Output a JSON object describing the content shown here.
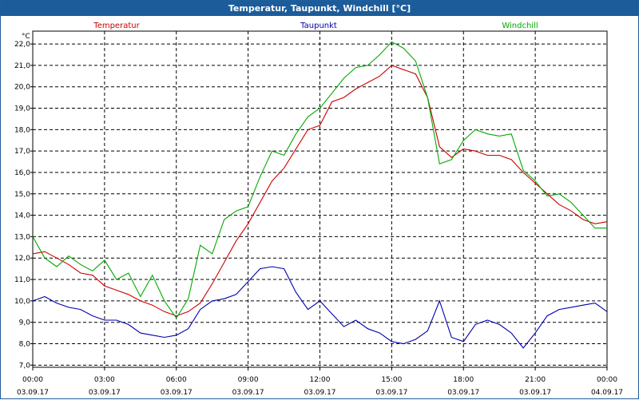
{
  "window": {
    "title": "Temperatur, Taupunkt, Windchill [°C]"
  },
  "colors": {
    "titlebar": "#1c5c9a",
    "grid": "#000000",
    "axis": "#000000"
  },
  "chart_data": {
    "type": "line",
    "ylabel": "°C",
    "ylim": [
      6.9,
      22.6
    ],
    "yticks": [
      "22,0",
      "21,0",
      "20,0",
      "19,0",
      "18,0",
      "17,0",
      "16,0",
      "15,0",
      "14,0",
      "13,0",
      "12,0",
      "11,0",
      "10,0",
      "9,0",
      "8,0",
      "7,0"
    ],
    "ytick_values": [
      22,
      21,
      20,
      19,
      18,
      17,
      16,
      15,
      14,
      13,
      12,
      11,
      10,
      9,
      8,
      7
    ],
    "x_hours": [
      0,
      3,
      6,
      9,
      12,
      15,
      18,
      21,
      24
    ],
    "x_time_labels": [
      "00:00",
      "03:00",
      "06:00",
      "09:00",
      "12:00",
      "15:00",
      "18:00",
      "21:00",
      "00:00"
    ],
    "x_date_labels": [
      "03.09.17",
      "03.09.17",
      "03.09.17",
      "03.09.17",
      "03.09.17",
      "03.09.17",
      "03.09.17",
      "03.09.17",
      "04.09.17"
    ],
    "xlim": [
      0,
      24
    ],
    "grid": true,
    "legend_position": "top",
    "series": [
      {
        "name": "Temperatur",
        "color": "#cc0000",
        "x": [
          0,
          0.5,
          1,
          1.5,
          2,
          2.5,
          3,
          3.5,
          4,
          4.5,
          5,
          5.5,
          6,
          6.5,
          7,
          7.5,
          8,
          8.5,
          9,
          9.5,
          10,
          10.5,
          11,
          11.5,
          12,
          12.5,
          13,
          13.5,
          14,
          14.5,
          15,
          15.5,
          16,
          16.5,
          17,
          17.5,
          18,
          18.5,
          19,
          19.5,
          20,
          20.5,
          21,
          21.5,
          22,
          22.5,
          23,
          23.5,
          24
        ],
        "values": [
          12.2,
          12.3,
          12.0,
          11.7,
          11.3,
          11.2,
          10.7,
          10.5,
          10.3,
          10.0,
          9.8,
          9.5,
          9.3,
          9.5,
          9.9,
          10.8,
          11.8,
          12.8,
          13.6,
          14.6,
          15.6,
          16.2,
          17.1,
          18.0,
          18.2,
          19.3,
          19.5,
          19.9,
          20.2,
          20.5,
          21.0,
          20.8,
          20.6,
          19.5,
          17.2,
          16.7,
          17.1,
          17.0,
          16.8,
          16.8,
          16.6,
          16.0,
          15.5,
          15.0,
          14.5,
          14.2,
          13.8,
          13.6,
          13.7
        ]
      },
      {
        "name": "Taupunkt",
        "color": "#0000aa",
        "x": [
          0,
          0.5,
          1,
          1.5,
          2,
          2.5,
          3,
          3.5,
          4,
          4.5,
          5,
          5.5,
          6,
          6.5,
          7,
          7.5,
          8,
          8.5,
          9,
          9.5,
          10,
          10.5,
          11,
          11.5,
          12,
          12.5,
          13,
          13.5,
          14,
          14.5,
          15,
          15.5,
          16,
          16.5,
          17,
          17.5,
          18,
          18.5,
          19,
          19.5,
          20,
          20.5,
          21,
          21.5,
          22,
          22.5,
          23,
          23.5,
          24
        ],
        "values": [
          10.0,
          10.2,
          9.9,
          9.7,
          9.6,
          9.3,
          9.1,
          9.1,
          8.9,
          8.5,
          8.4,
          8.3,
          8.4,
          8.7,
          9.6,
          10.0,
          10.1,
          10.3,
          10.9,
          11.5,
          11.6,
          11.5,
          10.4,
          9.6,
          10.0,
          9.4,
          8.8,
          9.1,
          8.7,
          8.5,
          8.1,
          8.0,
          8.2,
          8.6,
          10.0,
          8.3,
          8.1,
          8.9,
          9.1,
          8.9,
          8.5,
          7.8,
          8.5,
          9.3,
          9.6,
          9.7,
          9.8,
          9.9,
          9.5
        ]
      },
      {
        "name": "Windchill",
        "color": "#00aa00",
        "x": [
          0,
          0.5,
          1,
          1.5,
          2,
          2.5,
          3,
          3.5,
          4,
          4.5,
          5,
          5.5,
          6,
          6.5,
          7,
          7.5,
          8,
          8.5,
          9,
          9.5,
          10,
          10.5,
          11,
          11.5,
          12,
          12.5,
          13,
          13.5,
          14,
          14.5,
          15,
          15.5,
          16,
          16.5,
          17,
          17.5,
          18,
          18.5,
          19,
          19.5,
          20,
          20.5,
          21,
          21.5,
          22,
          22.5,
          23,
          23.5,
          24
        ],
        "values": [
          13.0,
          12.0,
          11.6,
          12.1,
          11.7,
          11.4,
          11.9,
          11.0,
          11.3,
          10.2,
          11.2,
          10.0,
          9.2,
          10.1,
          12.6,
          12.2,
          13.8,
          14.2,
          14.4,
          15.8,
          17.0,
          16.8,
          17.8,
          18.6,
          19.0,
          19.7,
          20.4,
          20.9,
          21.0,
          21.5,
          22.1,
          21.8,
          21.2,
          19.5,
          16.4,
          16.6,
          17.5,
          18.0,
          17.8,
          17.7,
          17.8,
          16.1,
          15.6,
          14.9,
          15.0,
          14.6,
          14.0,
          13.4,
          13.4
        ]
      }
    ]
  }
}
